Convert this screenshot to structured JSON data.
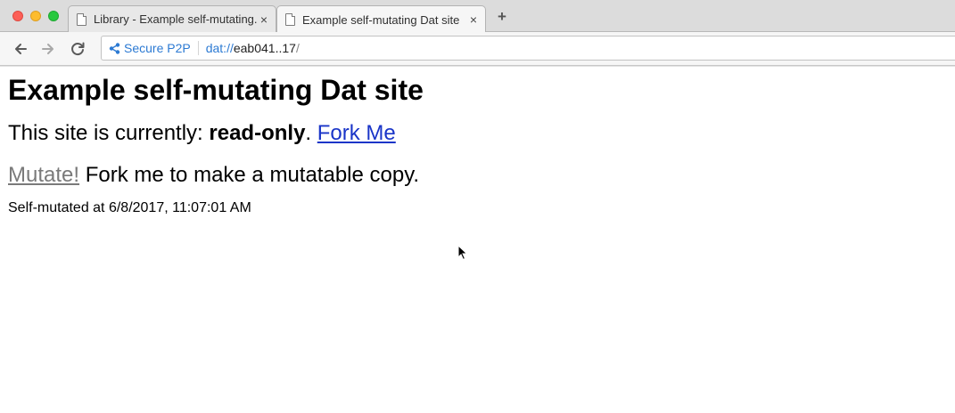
{
  "browser": {
    "tabs": [
      {
        "title": "Library - Example self-mutating..",
        "close": "×",
        "active": false
      },
      {
        "title": "Example self-mutating Dat site",
        "close": "×",
        "active": true
      }
    ],
    "new_tab_label": "+",
    "address": {
      "security_label": "Secure P2P",
      "scheme": "dat://",
      "host": "eab041..17",
      "path": "/"
    },
    "icons": [
      "back-arrow-icon",
      "forward-arrow-icon",
      "reload-icon",
      "share-nodes-icon",
      "page-icon",
      "close-icon"
    ]
  },
  "page": {
    "heading": "Example self-mutating Dat site",
    "status_prefix": "This site is currently: ",
    "status_value": "read-only",
    "status_suffix": ".",
    "fork_link": "Fork Me",
    "mutate_link": "Mutate!",
    "mutate_hint": " Fork me to make a mutatable copy.",
    "mutated_text": "Self-mutated at 6/8/2017, 11:07:01 AM"
  },
  "colors": {
    "link": "#1a35c8",
    "disabled_link": "#7a7a7a",
    "secure_accent": "#2c7ad3"
  }
}
